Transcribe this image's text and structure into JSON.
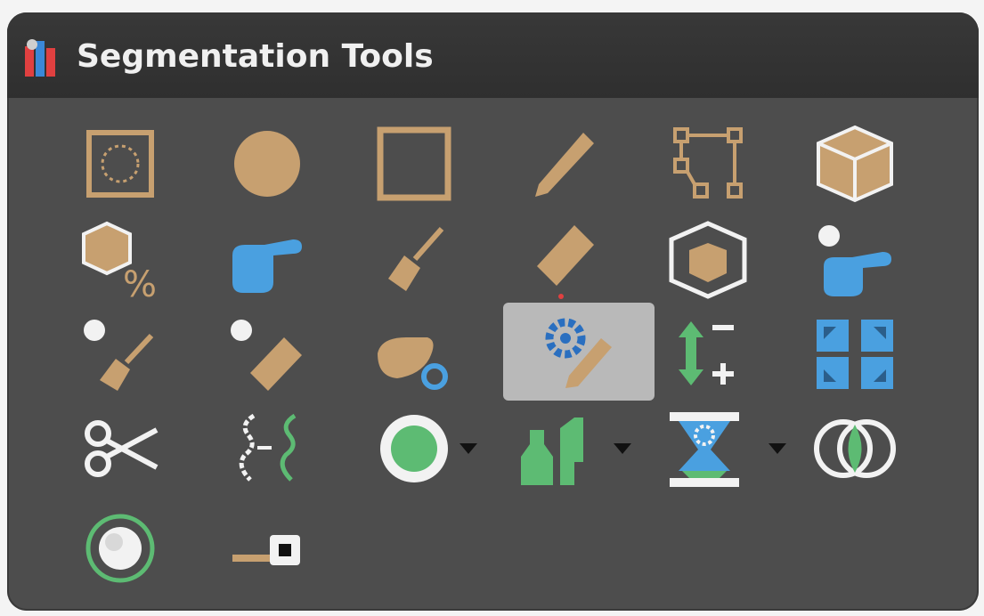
{
  "window": {
    "title": "Segmentation Tools",
    "title_icon": "segmentation-tools-icon"
  },
  "colors": {
    "tan": "#c7a070",
    "blue": "#4aa0e0",
    "green": "#5dbb73",
    "panel": "#4d4d4d",
    "selected": "#b9b9b9"
  },
  "tools": [
    {
      "name": "region-selection-icon"
    },
    {
      "name": "circle-icon"
    },
    {
      "name": "rectangle-icon"
    },
    {
      "name": "pencil-icon"
    },
    {
      "name": "polygon-icon"
    },
    {
      "name": "cube-icon"
    },
    {
      "name": "cube-percent-icon"
    },
    {
      "name": "pointing-hand-icon"
    },
    {
      "name": "brush-icon"
    },
    {
      "name": "eraser-icon"
    },
    {
      "name": "cube-outline-icon"
    },
    {
      "name": "pointing-hand-dot-icon"
    },
    {
      "name": "brush-dot-icon"
    },
    {
      "name": "eraser-dot-icon"
    },
    {
      "name": "organ-gear-icon"
    },
    {
      "name": "gear-pencil-icon",
      "selected": true
    },
    {
      "name": "grow-shrink-icon"
    },
    {
      "name": "expand-arrows-icon"
    },
    {
      "name": "scissors-icon"
    },
    {
      "name": "contour-transfer-icon"
    },
    {
      "name": "green-circle-icon",
      "dropdown": true
    },
    {
      "name": "bottles-icon",
      "dropdown": true
    },
    {
      "name": "hourglass-gear-icon",
      "dropdown": true
    },
    {
      "name": "venn-intersect-icon"
    },
    {
      "name": "sphere-icon"
    },
    {
      "name": "slider-icon"
    }
  ]
}
